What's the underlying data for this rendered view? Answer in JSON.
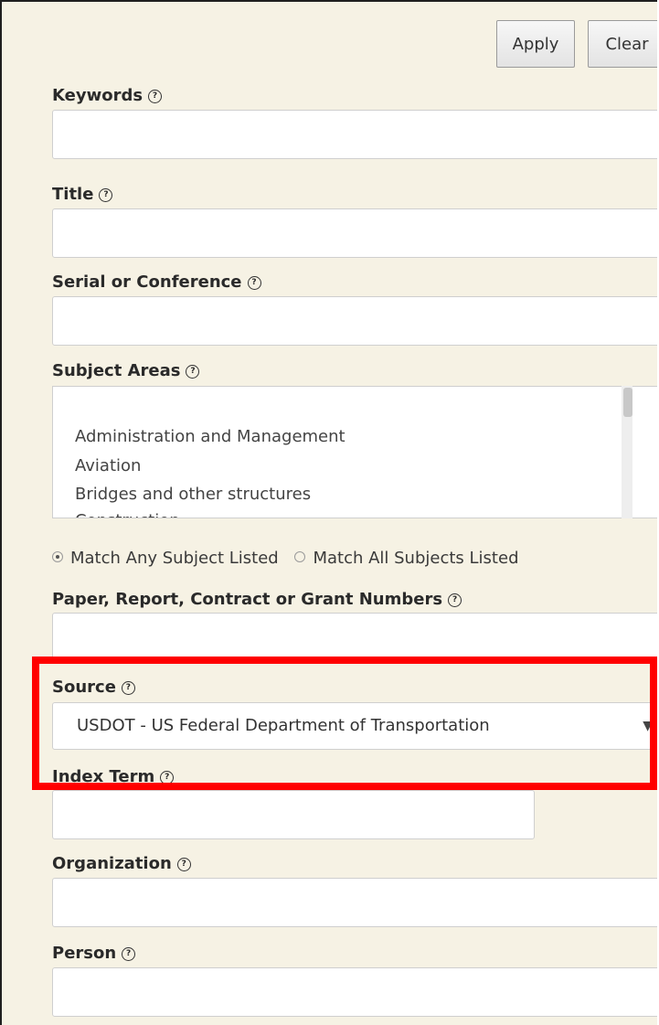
{
  "buttons": {
    "apply": "Apply",
    "clear": "Clear"
  },
  "help_glyph": "?",
  "fields": {
    "keywords": {
      "label": "Keywords",
      "value": ""
    },
    "title": {
      "label": "Title",
      "value": ""
    },
    "serial": {
      "label": "Serial or Conference",
      "value": ""
    },
    "subject_areas": {
      "label": "Subject Areas",
      "options": [
        "Administration and Management",
        "Aviation",
        "Bridges and other structures",
        "Construction"
      ]
    },
    "match": {
      "any_label": "Match Any Subject Listed",
      "all_label": "Match All Subjects Listed",
      "selected": "any"
    },
    "numbers": {
      "label": "Paper, Report, Contract or Grant Numbers",
      "value": ""
    },
    "source": {
      "label": "Source",
      "value": "USDOT - US Federal Department of Transportation"
    },
    "index_term": {
      "label": "Index Term",
      "value": ""
    },
    "organization": {
      "label": "Organization",
      "value": ""
    },
    "person": {
      "label": "Person",
      "value": ""
    }
  },
  "colors": {
    "panel_bg": "#f6f2e4",
    "highlight": "#ff0000"
  }
}
